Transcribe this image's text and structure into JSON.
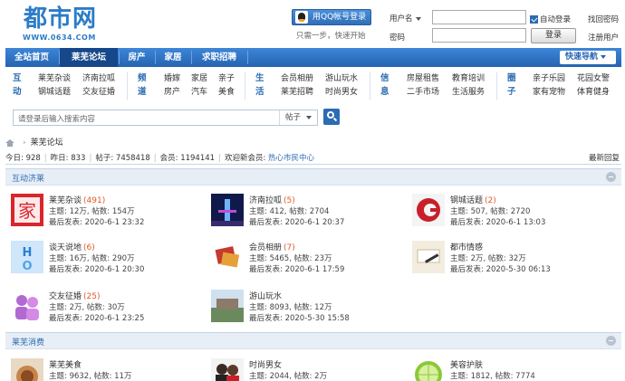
{
  "header": {
    "logo_text": "都市网",
    "logo_url": "WWW.0634.COM",
    "qq_login_label": "用QQ帐号登录",
    "qq_hint": "只需一步，快速开始",
    "username_label": "用户名",
    "password_label": "密码",
    "auto_login_label": "自动登录",
    "login_button": "登录",
    "forgot_password": "找回密码",
    "register": "注册用户"
  },
  "nav": {
    "items": [
      {
        "label": "全站首页"
      },
      {
        "label": "莱芜论坛"
      },
      {
        "label": "房产"
      },
      {
        "label": "家居"
      },
      {
        "label": "求职招聘"
      }
    ],
    "active_index": 1,
    "quick_nav": "快速导航"
  },
  "categories": [
    {
      "title": "互动",
      "links": [
        "莱芜杂谈",
        "济南拉呱",
        "钢城话题",
        "交友征婚"
      ]
    },
    {
      "title": "频道",
      "links": [
        "婚嫁",
        "家居",
        "亲子",
        "房产",
        "汽车",
        "美食"
      ]
    },
    {
      "title": "生活",
      "links": [
        "会员相册",
        "游山玩水",
        "莱芜招聘",
        "时尚男女"
      ]
    },
    {
      "title": "信息",
      "links": [
        "房屋租售",
        "教育培训",
        "二手市场",
        "生活服务"
      ]
    },
    {
      "title": "圈子",
      "links": [
        "亲子乐园",
        "花园女警",
        "家有宠物",
        "体育健身"
      ]
    }
  ],
  "search": {
    "placeholder": "请登录后输入搜索内容",
    "type": "帖子"
  },
  "breadcrumb": {
    "current": "莱芜论坛"
  },
  "stats": {
    "today": "今日: 928",
    "yesterday": "昨日: 833",
    "posts": "帖子: 7458418",
    "members": "会员: 1194141",
    "welcome": "欢迎新会员:",
    "new_member": "热心市民中心",
    "latest_reply": "最新回复"
  },
  "sections": [
    {
      "title": "互动济莱",
      "forums": [
        {
          "name": "莱芜杂谈",
          "count": "(491)",
          "meta": "主题: 12万, 帖数: 154万",
          "last": "最后发表: 2020-6-1 23:32"
        },
        {
          "name": "济南拉呱",
          "count": "(5)",
          "meta": "主题: 412, 帖数: 2704",
          "last": "最后发表: 2020-6-1 20:37"
        },
        {
          "name": "钢城话题",
          "count": "(2)",
          "meta": "主题: 507, 帖数: 2720",
          "last": "最后发表: 2020-6-1 13:03"
        },
        {
          "name": "谈天说地",
          "count": "(6)",
          "meta": "主题: 16万, 帖数: 290万",
          "last": "最后发表: 2020-6-1 20:30"
        },
        {
          "name": "会员相册",
          "count": "(7)",
          "meta": "主题: 5465, 帖数: 23万",
          "last": "最后发表: 2020-6-1 17:59"
        },
        {
          "name": "都市情感",
          "count": "",
          "meta": "主题: 2万, 帖数: 32万",
          "last": "最后发表: 2020-5-30 06:13"
        },
        {
          "name": "交友征婚",
          "count": "(25)",
          "meta": "主题: 2万, 帖数: 30万",
          "last": "最后发表: 2020-6-1 23:25"
        },
        {
          "name": "游山玩水",
          "count": "",
          "meta": "主题: 8093, 帖数: 12万",
          "last": "最后发表: 2020-5-30 15:58"
        }
      ]
    },
    {
      "title": "莱芜消费",
      "forums": [
        {
          "name": "莱芜美食",
          "count": "",
          "meta": "主题: 9632, 帖数: 11万",
          "last": ""
        },
        {
          "name": "时尚男女",
          "count": "",
          "meta": "主题: 2044, 帖数: 2万",
          "last": ""
        },
        {
          "name": "美容护肤",
          "count": "",
          "meta": "主题: 1812, 帖数: 7774",
          "last": ""
        }
      ]
    }
  ],
  "colors": {
    "brand_blue": "#2b6cb3",
    "nav_active": "#15478a",
    "count_orange": "#e05a2a"
  }
}
